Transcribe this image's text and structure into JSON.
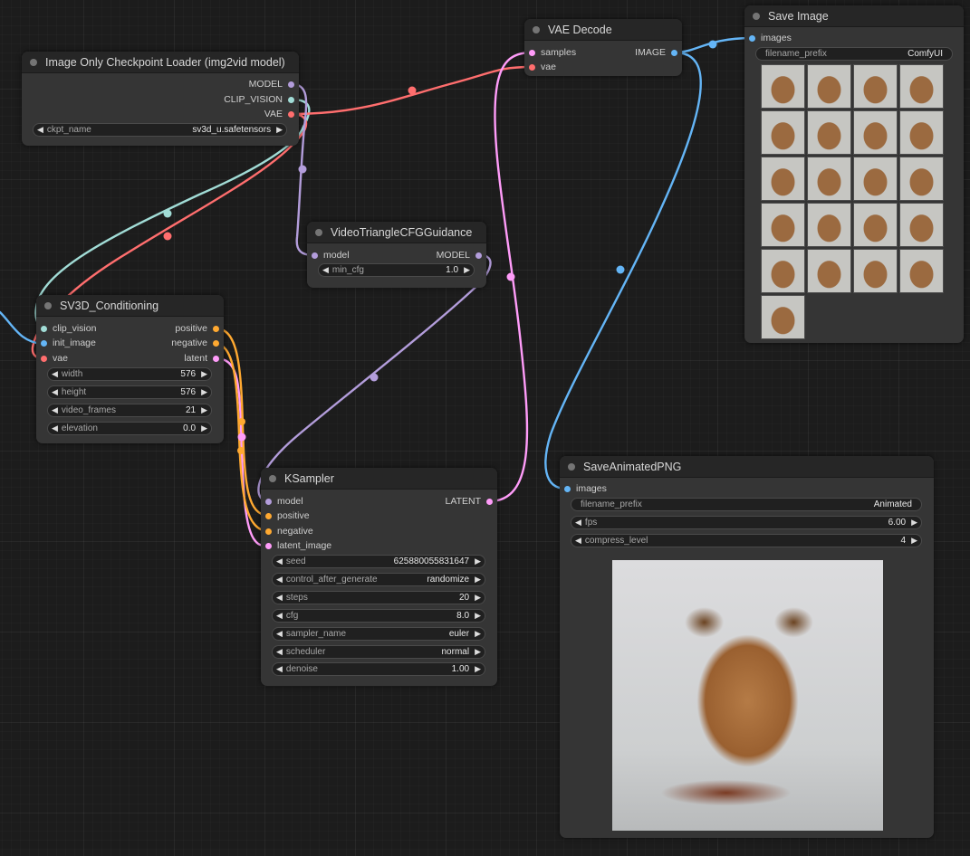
{
  "canvas": {
    "background": "#1c1c1c"
  },
  "colors": {
    "model": "#b39ddb",
    "clip_vision": "#a1dcd6",
    "vae": "#ff6e6e",
    "image": "#64b5f6",
    "latent": "#ff9cf9",
    "conditioning": "#ffa931"
  },
  "nodes": {
    "checkpoint": {
      "title": "Image Only Checkpoint Loader (img2vid model)",
      "outputs": [
        "MODEL",
        "CLIP_VISION",
        "VAE"
      ],
      "widgets": [
        {
          "label": "ckpt_name",
          "value": "sv3d_u.safetensors"
        }
      ]
    },
    "vae_decode": {
      "title": "VAE Decode",
      "inputs": [
        "samples",
        "vae"
      ],
      "outputs": [
        "IMAGE"
      ]
    },
    "save_image": {
      "title": "Save Image",
      "inputs": [
        "images"
      ],
      "widgets": [
        {
          "label": "filename_prefix",
          "value": "ComfyUI"
        }
      ]
    },
    "guidance": {
      "title": "VideoTriangleCFGGuidance",
      "inputs": [
        "model"
      ],
      "outputs": [
        "MODEL"
      ],
      "widgets": [
        {
          "label": "min_cfg",
          "value": "1.0"
        }
      ]
    },
    "sv3d": {
      "title": "SV3D_Conditioning",
      "inputs": [
        "clip_vision",
        "init_image",
        "vae"
      ],
      "outputs": [
        "positive",
        "negative",
        "latent"
      ],
      "widgets": [
        {
          "label": "width",
          "value": "576"
        },
        {
          "label": "height",
          "value": "576"
        },
        {
          "label": "video_frames",
          "value": "21"
        },
        {
          "label": "elevation",
          "value": "0.0"
        }
      ]
    },
    "ksampler": {
      "title": "KSampler",
      "inputs": [
        "model",
        "positive",
        "negative",
        "latent_image"
      ],
      "outputs": [
        "LATENT"
      ],
      "widgets": [
        {
          "label": "seed",
          "value": "625880055831647"
        },
        {
          "label": "control_after_generate",
          "value": "randomize"
        },
        {
          "label": "steps",
          "value": "20"
        },
        {
          "label": "cfg",
          "value": "8.0"
        },
        {
          "label": "sampler_name",
          "value": "euler"
        },
        {
          "label": "scheduler",
          "value": "normal"
        },
        {
          "label": "denoise",
          "value": "1.00"
        }
      ]
    },
    "save_png": {
      "title": "SaveAnimatedPNG",
      "inputs": [
        "images"
      ],
      "widgets": [
        {
          "label": "filename_prefix",
          "value": "Animated"
        },
        {
          "label": "fps",
          "value": "6.00"
        },
        {
          "label": "compress_level",
          "value": "4"
        }
      ]
    }
  },
  "icons": {
    "decrement": "triangle-left-icon",
    "increment": "triangle-right-icon",
    "status": "node-status-dot-icon"
  }
}
